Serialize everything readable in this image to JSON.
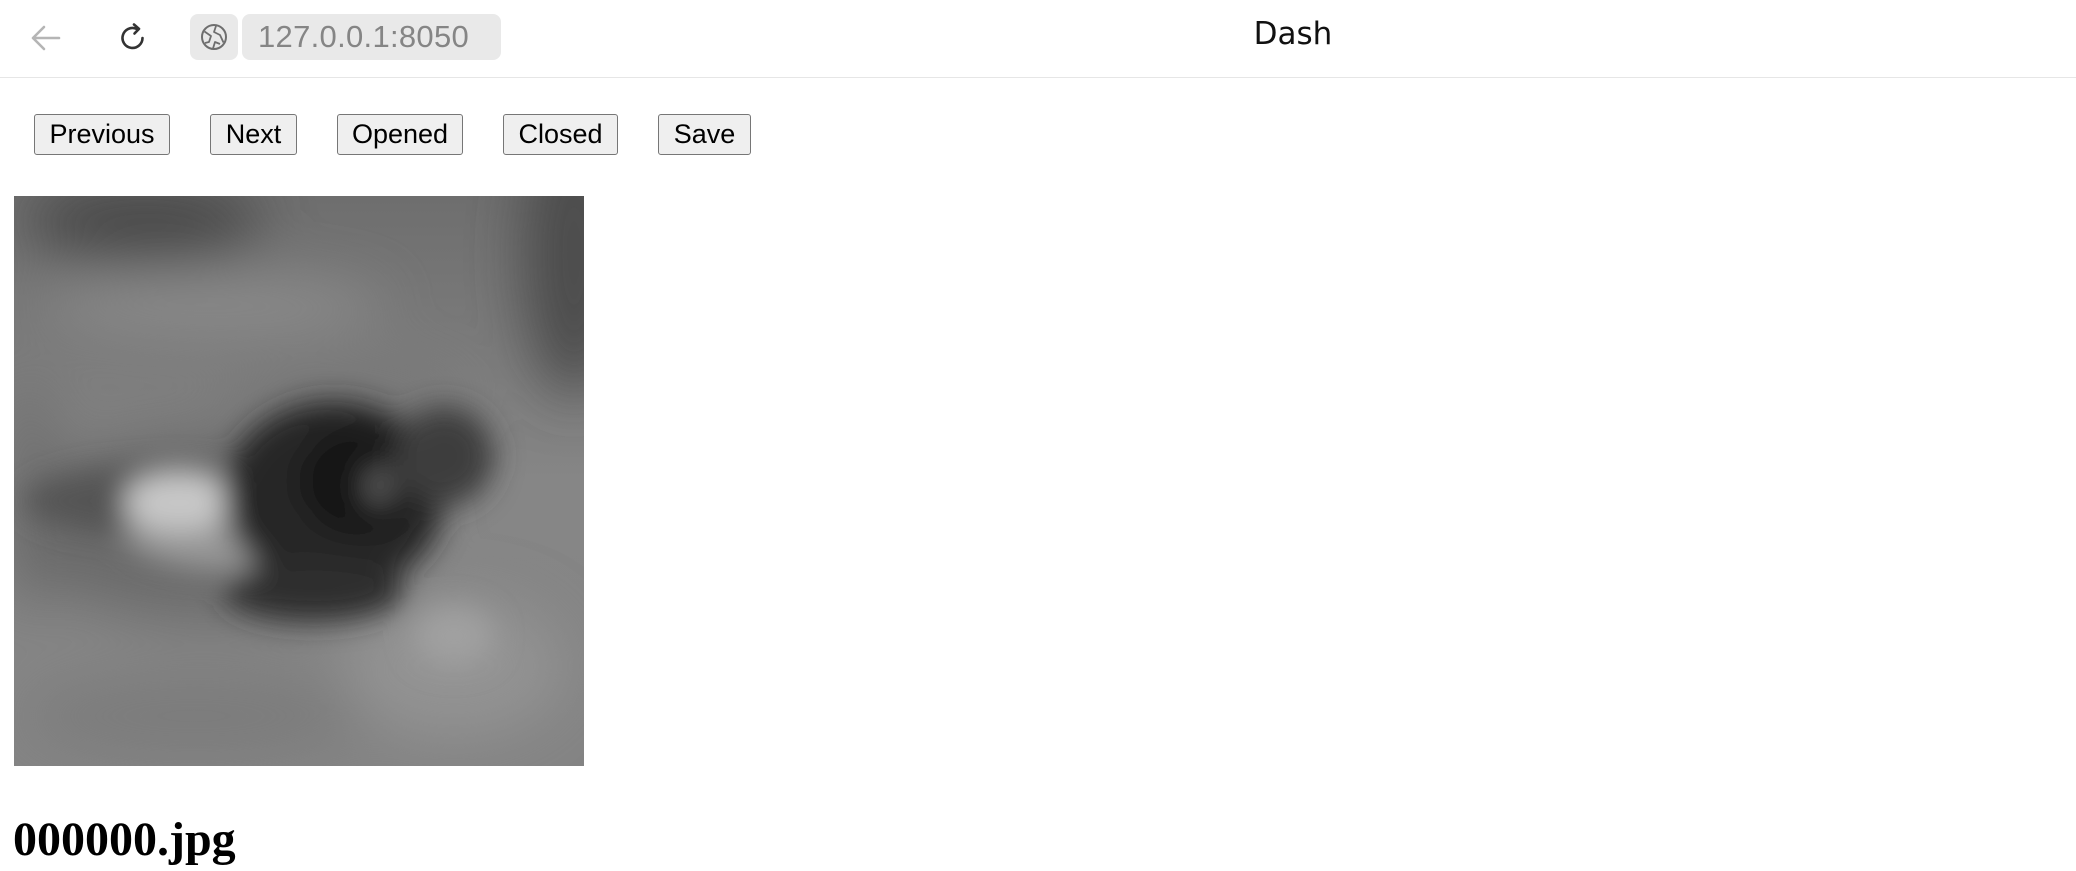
{
  "browser": {
    "url": "127.0.0.1:8050",
    "page_title": "Dash",
    "back_icon": "arrow-left-icon",
    "reload_icon": "reload-icon",
    "site_icon": "globe-icon"
  },
  "toolbar": {
    "previous_label": "Previous",
    "next_label": "Next",
    "opened_label": "Opened",
    "closed_label": "Closed",
    "save_label": "Save"
  },
  "content": {
    "image_description": "grayscale close-up of an open eye",
    "filename": "000000.jpg"
  }
}
